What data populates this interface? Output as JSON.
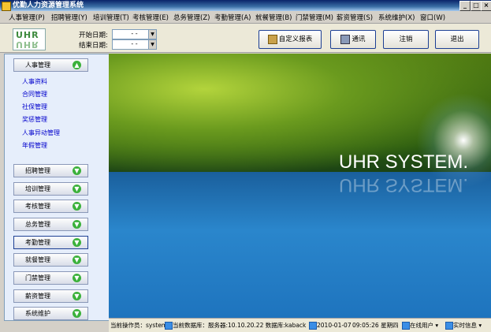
{
  "window": {
    "title": "优勤人力资源管理系统",
    "controls": [
      "_",
      "□",
      "×"
    ]
  },
  "menu": [
    "人事管理(P)",
    "招聘管理(Y)",
    "培训管理(T)",
    "考核管理(E)",
    "总务管理(Z)",
    "考勤管理(A)",
    "就餐管理(B)",
    "门禁管理(M)",
    "薪资管理(S)",
    "系统维护(X)",
    "窗口(W)"
  ],
  "toolbar": {
    "logo_text": "UHR",
    "start_date_label": "开始日期:",
    "end_date_label": "结束日期:",
    "start_date_value": "- -",
    "end_date_value": "- -",
    "custom_report": "自定义报表",
    "message": "通讯",
    "logout": "注销",
    "exit": "退出"
  },
  "sidebar": {
    "expanded_group": "人事管理",
    "links": [
      "人事资料",
      "合同管理",
      "社保管理",
      "奖惩管理",
      "人事异动管理",
      "年假管理"
    ],
    "groups": [
      "招聘管理",
      "培训管理",
      "考核管理",
      "总务管理",
      "考勤管理",
      "就餐管理",
      "门禁管理",
      "薪资管理",
      "系统维护"
    ],
    "selected_group": "考勤管理"
  },
  "banner": {
    "brand": "UHR SYSTEM."
  },
  "status": {
    "operator": "当前操作员：system",
    "database": "当前数据库：服务器:10.10.20.22  数据库:kaback",
    "date": "2010-01-07",
    "time": "09:05:26 星期四",
    "online_users": "在线用户 ▾",
    "realtime_info": "实时信息 ▾"
  },
  "colors": {
    "titlebar": "#0a246a",
    "link": "#0000cc",
    "arrow_green": "#3bb13b"
  }
}
